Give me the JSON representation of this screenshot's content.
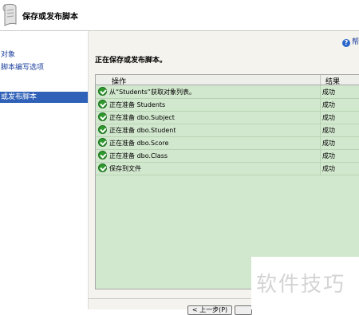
{
  "header": {
    "title": "保存或发布脚本"
  },
  "sidebar": {
    "items": [
      {
        "label": "对象"
      },
      {
        "label": "脚本编写选项"
      },
      {
        "label": "或发布脚本"
      }
    ]
  },
  "main": {
    "help_label": "帮",
    "title": "正在保存或发布脚本。",
    "columns": {
      "operation": "操作",
      "result": "结果"
    },
    "rows": [
      {
        "operation": "从“Students”获取对象列表。",
        "result": "成功"
      },
      {
        "operation": "正在准备 Students",
        "result": "成功"
      },
      {
        "operation": "正在准备 dbo.Subject",
        "result": "成功"
      },
      {
        "operation": "正在准备 dbo.Student",
        "result": "成功"
      },
      {
        "operation": "正在准备 dbo.Score",
        "result": "成功"
      },
      {
        "operation": "正在准备 dbo.Class",
        "result": "成功"
      },
      {
        "operation": "保存到文件",
        "result": "成功"
      }
    ]
  },
  "footer": {
    "prev_button": "< 上一步(P)"
  },
  "watermark": {
    "text": "软件技巧"
  },
  "colors": {
    "success": "#2e9a2e",
    "accent": "#2f61b8",
    "panel": "#d2e8ce"
  }
}
